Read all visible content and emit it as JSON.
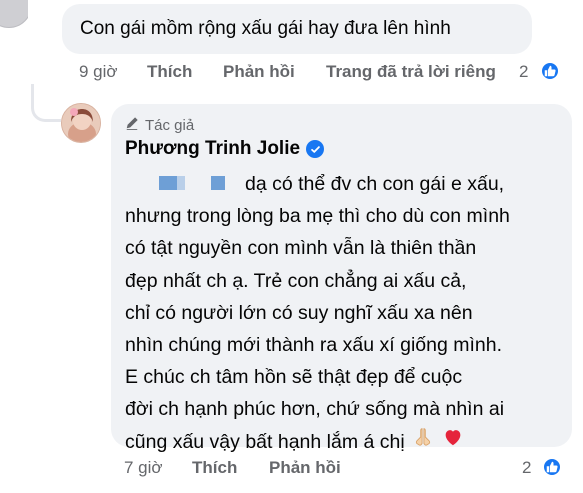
{
  "top_comment": {
    "text": "Con gái mồm rộng xấu gái hay đưa lên hình",
    "time": "9 giờ",
    "like_label": "Thích",
    "reply_label": "Phản hồi",
    "page_replied_label": "Trang đã trả lời riêng",
    "reaction_count": "2"
  },
  "reply": {
    "author_tag": "Tác giả",
    "author_name": "Phương Trinh Jolie",
    "lines": [
      "dạ có thể đv ch con gái e xấu,",
      "nhưng trong lòng ba mẹ thì cho dù con mình",
      "có tật nguyền con mình vẫn là thiên thần",
      "đẹp nhất ch ạ. Trẻ con chẳng ai xấu cả,",
      "chỉ có người lớn có suy nghĩ xấu xa nên",
      "nhìn chúng mới thành ra xấu xí giống mình.",
      "E chúc ch tâm hồn sẽ thật đẹp để cuộc",
      "đời ch hạnh phúc hơn, chứ sống mà nhìn ai",
      "cũng xấu vậy bất hạnh lắm á chị"
    ],
    "time": "7 giờ",
    "like_label": "Thích",
    "reply_label": "Phản hồi",
    "reaction_count": "2",
    "emojis": [
      "folded-hands",
      "red-heart"
    ]
  },
  "colors": {
    "accent": "#1877f2",
    "bubble_bg": "#f0f2f5",
    "meta_text": "#65676b",
    "redaction": "#6e9fd6"
  }
}
